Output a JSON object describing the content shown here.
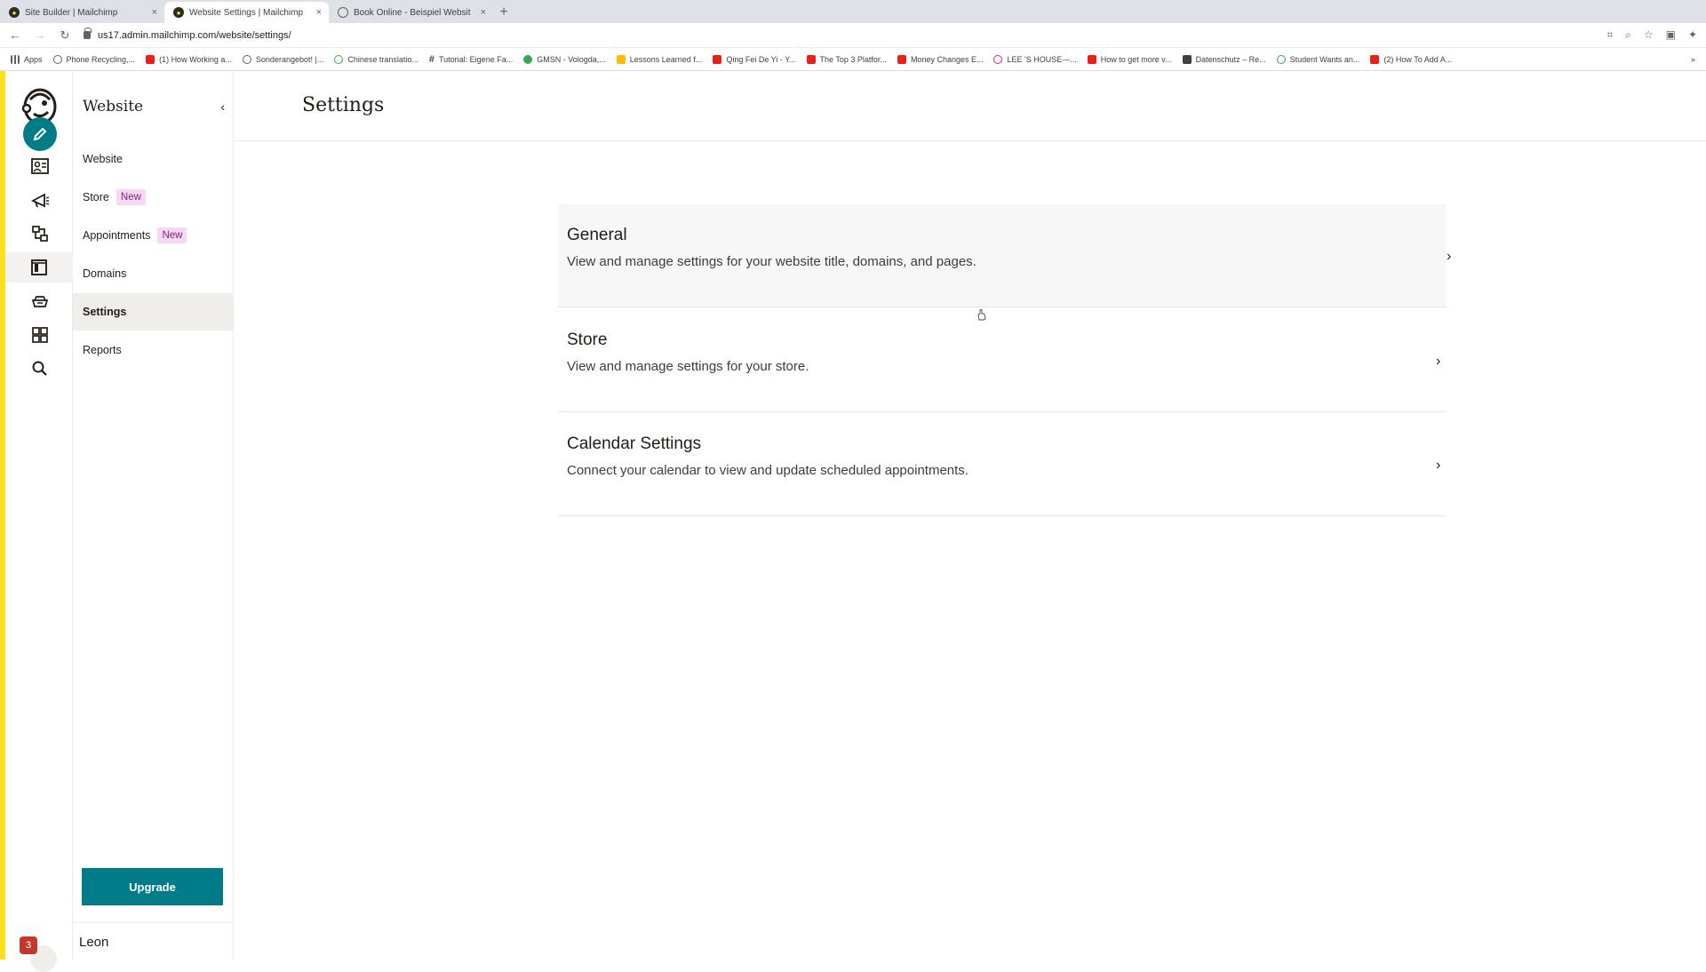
{
  "browser": {
    "tabs": [
      {
        "label": "Site Builder | Mailchimp",
        "close": "×"
      },
      {
        "label": "Website Settings | Mailchimp",
        "close": "×"
      },
      {
        "label": "Book Online - Beispiel Websit",
        "close": "×"
      }
    ],
    "new_tab": "+",
    "url": "us17.admin.mailchimp.com/website/settings/",
    "bookmarks": [
      {
        "label": "Apps",
        "color": "#5f6368"
      },
      {
        "label": "Phone Recycling,...",
        "color": "#5f6368"
      },
      {
        "label": "(1) How Working a...",
        "color": "#e62117"
      },
      {
        "label": "Sonderangebot! |...",
        "color": "#5f6368"
      },
      {
        "label": "Chinese translatio...",
        "color": "#34a853"
      },
      {
        "label": "Tutorial: Eigene Fa...",
        "color": "#3c4043"
      },
      {
        "label": "GMSN - Vologda,...",
        "color": "#34a853"
      },
      {
        "label": "Lessons Learned f...",
        "color": "#fbbc04"
      },
      {
        "label": "Qing Fei De Yi - Y...",
        "color": "#e62117"
      },
      {
        "label": "The Top 3 Platfor...",
        "color": "#e62117"
      },
      {
        "label": "Money Changes E...",
        "color": "#e62117"
      },
      {
        "label": "LEE 'S HOUSE—...",
        "color": "#e91e63"
      },
      {
        "label": "How to get more v...",
        "color": "#e62117"
      },
      {
        "label": "Datenschutz – Re...",
        "color": "#3c4043"
      },
      {
        "label": "Student Wants an...",
        "color": "#34a853"
      },
      {
        "label": "(2) How To Add A...",
        "color": "#e62117"
      }
    ],
    "bookmarks_more": "»"
  },
  "subnav": {
    "title": "Website",
    "collapse": "‹",
    "items": [
      {
        "label": "Website",
        "badge": ""
      },
      {
        "label": "Store",
        "badge": "New"
      },
      {
        "label": "Appointments",
        "badge": "New"
      },
      {
        "label": "Domains",
        "badge": ""
      },
      {
        "label": "Settings",
        "badge": ""
      },
      {
        "label": "Reports",
        "badge": ""
      }
    ],
    "upgrade_label": "Upgrade",
    "user_name": "Leon",
    "notification_count": "3"
  },
  "main": {
    "page_title": "Settings",
    "cards": [
      {
        "title": "General",
        "description": "View and manage settings for your website title, domains, and pages.",
        "chevron": "›"
      },
      {
        "title": "Store",
        "description": "View and manage settings for your store.",
        "chevron": "›"
      },
      {
        "title": "Calendar Settings",
        "description": "Connect your calendar to view and update scheduled appointments.",
        "chevron": "›"
      }
    ]
  },
  "colors": {
    "accent": "#007c89",
    "brand_yellow": "#ffe01b",
    "badge_bg": "#f5d9f2",
    "badge_text": "#8d1e82"
  },
  "icons": [
    "mailchimp-logo-icon",
    "pencil-icon",
    "audience-icon",
    "campaign-icon",
    "automation-icon",
    "website-icon",
    "content-icon",
    "integrations-icon",
    "search-icon"
  ]
}
